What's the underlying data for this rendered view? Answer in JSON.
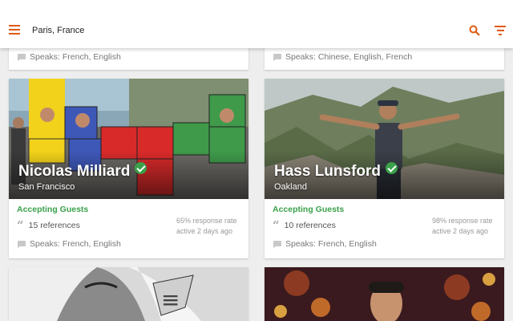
{
  "header": {
    "location": "Paris, France"
  },
  "top_cards": [
    {
      "speaks": "Speaks: French, English"
    },
    {
      "speaks": "Speaks: Chinese, English, French"
    }
  ],
  "hosts": [
    {
      "name": "Nicolas Milliard",
      "city": "San Francisco",
      "status": "Accepting Guests",
      "references": "15 references",
      "response_rate": "65% response rate",
      "active": "active 2 days ago",
      "speaks": "Speaks: French, English"
    },
    {
      "name": "Hass Lunsford",
      "city": "Oakland",
      "status": "Accepting Guests",
      "references": "10 references",
      "response_rate": "98% response rate",
      "active": "active 2 days ago",
      "speaks": "Speaks: French, English"
    }
  ],
  "colors": {
    "accent": "#e05a12",
    "accepting": "#3aa14a"
  },
  "icons": [
    "menu-icon",
    "search-icon",
    "filter-icon",
    "chat-bubble-icon",
    "quote-icon",
    "verified-check-icon"
  ]
}
